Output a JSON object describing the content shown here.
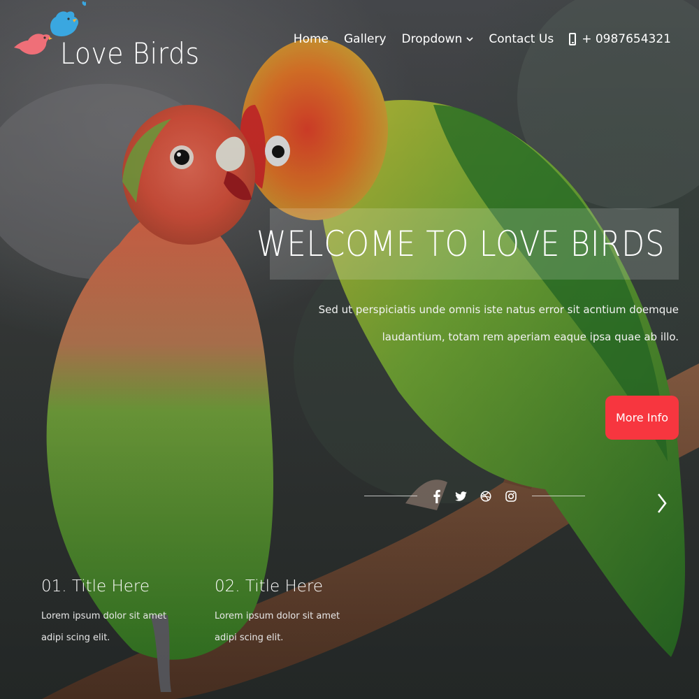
{
  "brand": {
    "name": "Love Birds"
  },
  "nav": {
    "items": [
      {
        "label": "Home"
      },
      {
        "label": "Gallery"
      },
      {
        "label": "Dropdown"
      },
      {
        "label": "Contact Us"
      }
    ],
    "phone": "+ 0987654321"
  },
  "hero": {
    "title": "WELCOME TO LOVE BIRDS",
    "description": "Sed ut perspiciatis unde omnis iste natus error sit acntium doemque laudantium, totam rem aperiam eaque ipsa quae ab illo.",
    "button_label": "More Info"
  },
  "social": [
    "facebook-icon",
    "twitter-icon",
    "dribbble-icon",
    "instagram-icon"
  ],
  "features": [
    {
      "title": "01. Title Here",
      "text": "Lorem ipsum dolor sit amet adipi scing elit."
    },
    {
      "title": "02. Title Here",
      "text": "Lorem ipsum dolor sit amet adipi scing elit."
    }
  ],
  "colors": {
    "accent": "#f7363f",
    "overlay": "rgba(255,255,255,0.16)"
  }
}
